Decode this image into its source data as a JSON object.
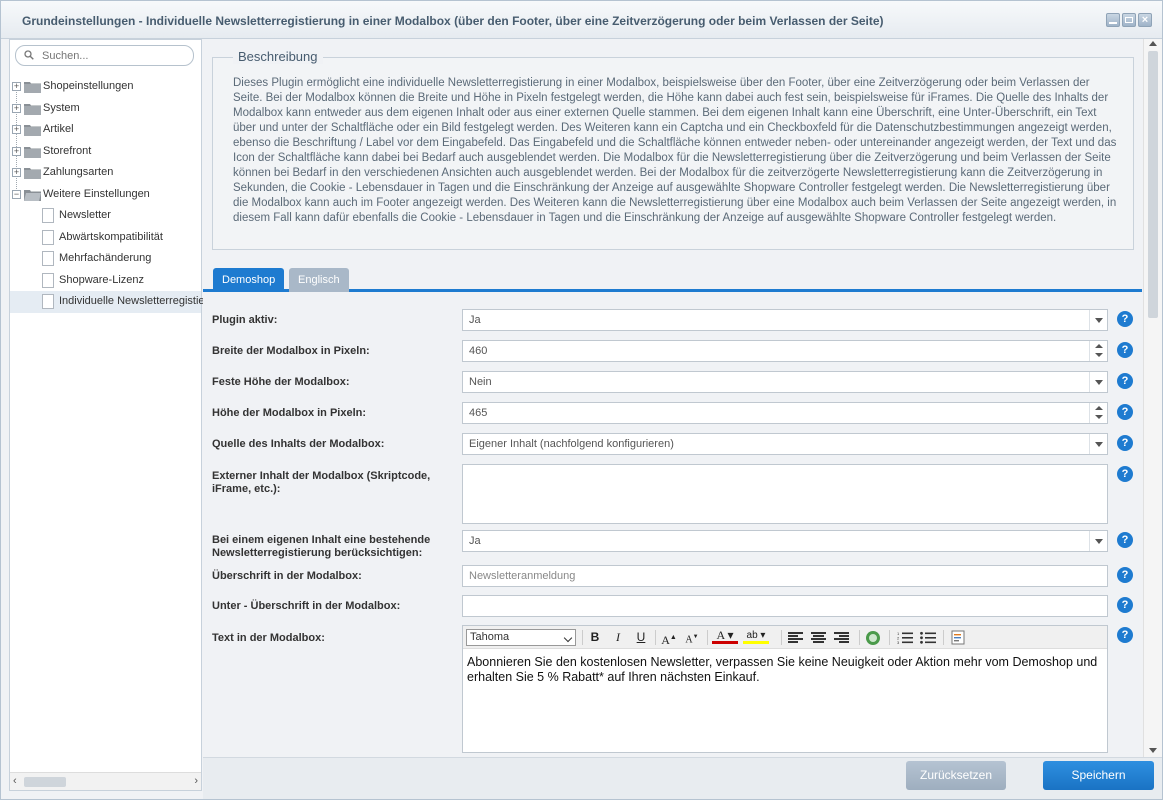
{
  "window": {
    "title": "Grundeinstellungen - Individuelle Newsletterregistierung in einer Modalbox (über den Footer, über eine Zeitverzögerung oder beim Verlassen der Seite)"
  },
  "sidebar": {
    "search_placeholder": "Suchen...",
    "folders": [
      {
        "label": "Shopeinstellungen"
      },
      {
        "label": "System"
      },
      {
        "label": "Artikel"
      },
      {
        "label": "Storefront"
      },
      {
        "label": "Zahlungsarten"
      },
      {
        "label": "Weitere Einstellungen"
      }
    ],
    "leaves": [
      {
        "label": "Newsletter"
      },
      {
        "label": "Abwärtskompatibilität"
      },
      {
        "label": "Mehrfachänderung"
      },
      {
        "label": "Shopware-Lizenz"
      },
      {
        "label": "Individuelle Newsletterregistier"
      }
    ]
  },
  "description": {
    "legend": "Beschreibung",
    "text": "Dieses Plugin ermöglicht eine individuelle Newsletterregistierung in einer Modalbox, beispielsweise über den Footer, über eine Zeitverzögerung oder beim Verlassen der Seite. Bei der Modalbox können die Breite und Höhe in Pixeln festgelegt werden, die Höhe kann dabei auch fest sein, beispielsweise für iFrames. Die Quelle des Inhalts der Modalbox kann entweder aus dem eigenen Inhalt oder aus einer externen Quelle stammen. Bei dem eigenen Inhalt kann eine Überschrift, eine Unter-Überschrift, ein Text über und unter der Schaltfläche oder ein Bild festgelegt werden. Des Weiteren kann ein Captcha und ein Checkboxfeld für die Datenschutzbestimmungen angezeigt werden, ebenso die Beschriftung / Label vor dem Eingabefeld. Das Eingabefeld und die Schaltfläche können entweder neben- oder untereinander angezeigt werden, der Text und das Icon der Schaltfläche kann dabei bei Bedarf auch ausgeblendet werden. Die Modalbox für die Newsletterregistierung über die Zeitverzögerung und beim Verlassen der Seite können bei Bedarf in den verschiedenen Ansichten auch ausgeblendet werden. Bei der Modalbox für die zeitverzögerte Newsletterregistierung kann die Zeitverzögerung in Sekunden, die Cookie - Lebensdauer in Tagen und die Einschränkung der Anzeige auf ausgewählte Shopware Controller festgelegt werden. Die Newsletterregistierung über die Modalbox kann auch im Footer angezeigt werden. Des Weiteren kann die Newsletterregistierung über eine Modalbox auch beim Verlassen der Seite angezeigt werden, in diesem Fall kann dafür ebenfalls die Cookie - Lebensdauer in Tagen und die Einschränkung der Anzeige auf ausgewählte Shopware Controller festgelegt werden."
  },
  "tabs": {
    "demoshop": "Demoshop",
    "englisch": "Englisch"
  },
  "form": {
    "plugin_active": {
      "label": "Plugin aktiv:",
      "value": "Ja"
    },
    "width": {
      "label": "Breite der Modalbox in Pixeln:",
      "value": "460"
    },
    "fixed_height": {
      "label": "Feste Höhe der Modalbox:",
      "value": "Nein"
    },
    "height": {
      "label": "Höhe der Modalbox in Pixeln:",
      "value": "465"
    },
    "source": {
      "label": "Quelle des Inhalts der Modalbox:",
      "value": "Eigener Inhalt (nachfolgend konfigurieren)"
    },
    "external": {
      "label": "Externer Inhalt der Modalbox (Skriptcode, iFrame, etc.):",
      "value": ""
    },
    "consider_existing": {
      "label": "Bei einem eigenen Inhalt eine bestehende Newsletterregistierung berücksichtigen:",
      "value": "Ja"
    },
    "heading": {
      "label": "Überschrift in der Modalbox:",
      "placeholder": "Newsletteranmeldung"
    },
    "subheading": {
      "label": "Unter - Überschrift in der Modalbox:",
      "value": ""
    },
    "text": {
      "label": "Text in der Modalbox:",
      "font": "Tahoma",
      "content": "Abonnieren Sie den kostenlosen Newsletter, verpassen Sie keine Neuigkeit oder Aktion mehr vom Demoshop und erhalten Sie 5 % Rabatt* auf Ihren nächsten Einkauf."
    },
    "help": "?"
  },
  "footer": {
    "reset": "Zurücksetzen",
    "save": "Speichern"
  },
  "colors": {
    "accent": "#1e7bd0",
    "tab_inactive": "#a9b8c8",
    "reset_button": "#a9b9ca"
  }
}
